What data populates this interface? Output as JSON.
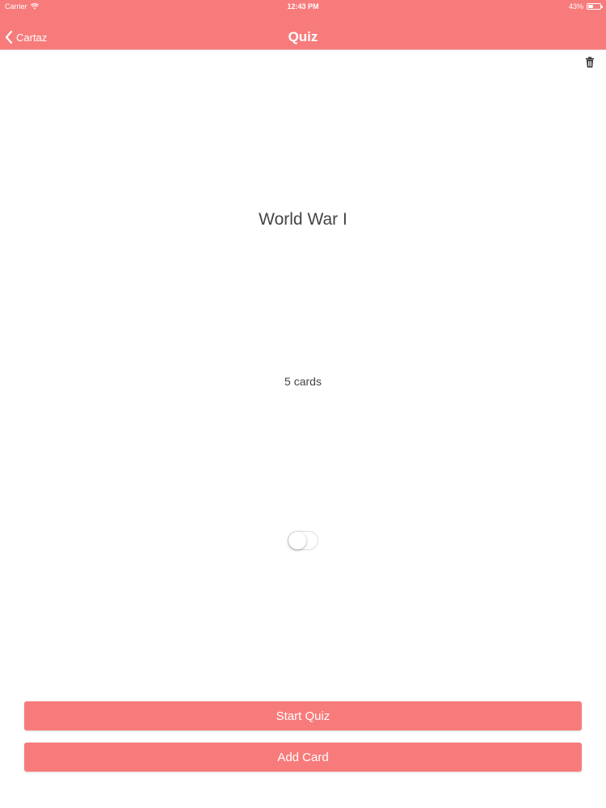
{
  "status_bar": {
    "carrier": "Carrier",
    "time": "12:43 PM",
    "battery": "43%",
    "battery_level": 0.43
  },
  "nav": {
    "back_label": "Cartaz",
    "title": "Quiz"
  },
  "deck": {
    "title": "World War I",
    "count": "5 cards"
  },
  "toggle": {
    "on": false
  },
  "actions": {
    "start_quiz": "Start Quiz",
    "add_card": "Add Card"
  },
  "colors": {
    "accent": "#F87B7B",
    "text": "#444444",
    "background": "#FFFFFF"
  },
  "icons": {
    "wifi": "wifi-icon",
    "battery": "battery-icon",
    "back": "chevron-left-icon",
    "trash": "trash-icon"
  }
}
